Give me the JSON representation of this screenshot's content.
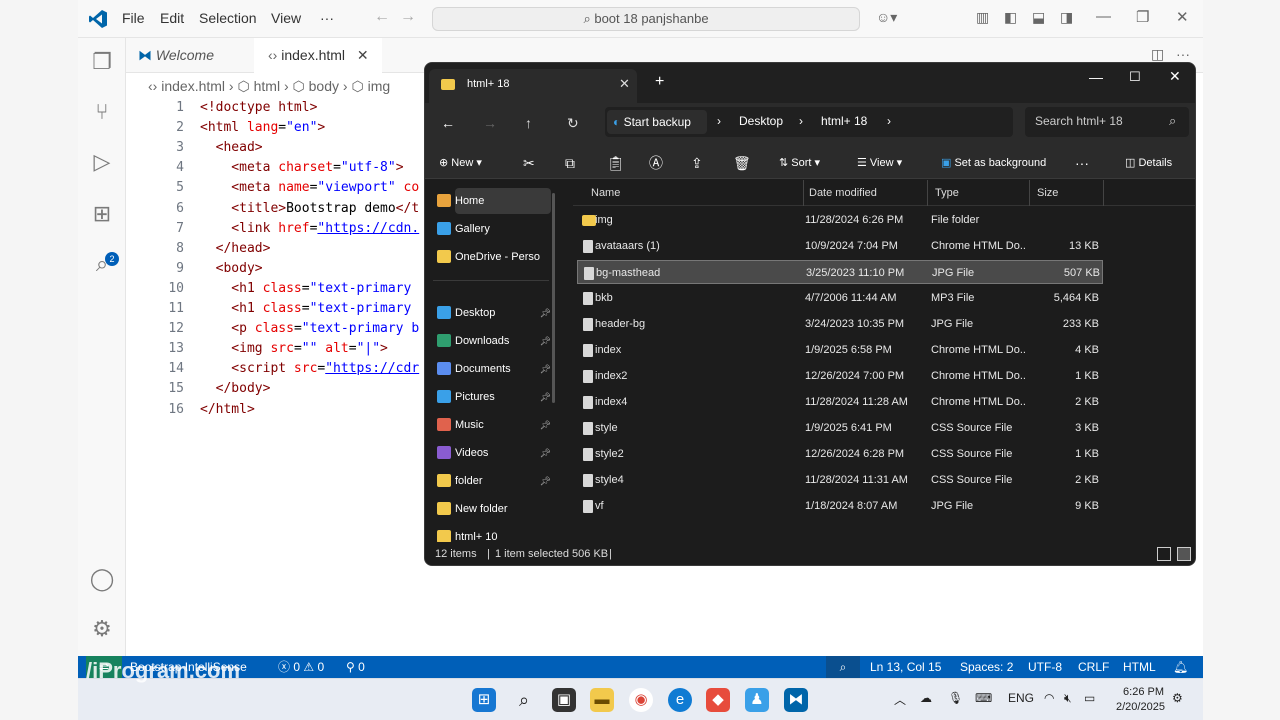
{
  "vscode": {
    "menu": [
      "File",
      "Edit",
      "Selection",
      "View",
      "···"
    ],
    "command_center": "boot 18 panjshanbe",
    "tabs": [
      {
        "label": "Welcome"
      },
      {
        "label": "index.html"
      }
    ],
    "breadcrumb": [
      "index.html",
      "html",
      "body",
      "img"
    ],
    "code_lines": [
      {
        "n": "1",
        "parts": [
          [
            "tag",
            "<!doctype html>"
          ]
        ]
      },
      {
        "n": "2",
        "parts": [
          [
            "tag",
            "<html "
          ],
          [
            "attr",
            "lang"
          ],
          [
            "pl",
            "="
          ],
          [
            "val",
            "\"en\""
          ],
          [
            "tag",
            ">"
          ]
        ]
      },
      {
        "n": "3",
        "parts": [
          [
            "tag",
            "  <head>"
          ]
        ]
      },
      {
        "n": "4",
        "parts": [
          [
            "tag",
            "    <meta "
          ],
          [
            "attr",
            "charset"
          ],
          [
            "pl",
            "="
          ],
          [
            "val",
            "\"utf-8\""
          ],
          [
            "tag",
            ">"
          ]
        ]
      },
      {
        "n": "5",
        "parts": [
          [
            "tag",
            "    <meta "
          ],
          [
            "attr",
            "name"
          ],
          [
            "pl",
            "="
          ],
          [
            "val",
            "\"viewport\""
          ],
          [
            "attr",
            " co"
          ]
        ]
      },
      {
        "n": "6",
        "parts": [
          [
            "tag",
            "    <title>"
          ],
          [
            "pl",
            "Bootstrap demo"
          ],
          [
            "tag",
            "</t"
          ]
        ]
      },
      {
        "n": "7",
        "parts": [
          [
            "tag",
            "    <link "
          ],
          [
            "attr",
            "href"
          ],
          [
            "pl",
            "="
          ],
          [
            "lnk",
            "\"https://cdn."
          ]
        ]
      },
      {
        "n": "8",
        "parts": [
          [
            "tag",
            "  </head>"
          ]
        ]
      },
      {
        "n": "9",
        "parts": [
          [
            "tag",
            "  <body>"
          ]
        ]
      },
      {
        "n": "10",
        "parts": [
          [
            "tag",
            "    <h1 "
          ],
          [
            "attr",
            "class"
          ],
          [
            "pl",
            "="
          ],
          [
            "val",
            "\"text-primary"
          ]
        ]
      },
      {
        "n": "11",
        "parts": [
          [
            "tag",
            "    <h1 "
          ],
          [
            "attr",
            "class"
          ],
          [
            "pl",
            "="
          ],
          [
            "val",
            "\"text-primary"
          ]
        ]
      },
      {
        "n": "12",
        "parts": [
          [
            "tag",
            "    <p "
          ],
          [
            "attr",
            "class"
          ],
          [
            "pl",
            "="
          ],
          [
            "val",
            "\"text-primary b"
          ]
        ]
      },
      {
        "n": "13",
        "parts": [
          [
            "tag",
            "    <img "
          ],
          [
            "attr",
            "src"
          ],
          [
            "pl",
            "="
          ],
          [
            "val",
            "\"\""
          ],
          [
            "attr",
            " alt"
          ],
          [
            "pl",
            "="
          ],
          [
            "val",
            "\"|\""
          ],
          [
            "tag",
            ">"
          ]
        ]
      },
      {
        "n": "14",
        "parts": [
          [
            "tag",
            "    <script "
          ],
          [
            "attr",
            "src"
          ],
          [
            "pl",
            "="
          ],
          [
            "lnk",
            "\"https://cdr"
          ]
        ]
      },
      {
        "n": "15",
        "parts": [
          [
            "tag",
            "  </body>"
          ]
        ]
      },
      {
        "n": "16",
        "parts": [
          [
            "tag",
            "</html>"
          ]
        ]
      }
    ],
    "status": {
      "remote": "Bootstrap IntelliSense",
      "errors": "0",
      "warnings": "0",
      "ports": "0",
      "position": "Ln 13, Col 15",
      "spaces": "Spaces: 2",
      "encoding": "UTF-8",
      "eol": "CRLF",
      "language": "HTML"
    },
    "watermark": "/iProgram.com",
    "taskbar": {
      "lang": "ENG",
      "time": "6:26 PM",
      "date": "2/20/2025"
    }
  },
  "explorer": {
    "tab_title": "html+ 18",
    "backup_label": "Start backup",
    "path": [
      "Desktop",
      "html+ 18"
    ],
    "search_placeholder": "Search html+ 18",
    "commands": {
      "new": "New",
      "sort": "Sort",
      "view": "View",
      "background": "Set as background",
      "details": "Details"
    },
    "sidebar": [
      {
        "label": "Home",
        "pinned": false,
        "color": "#e8a33d"
      },
      {
        "label": "Gallery",
        "pinned": false,
        "color": "#3aa0e8"
      },
      {
        "label": "OneDrive - Perso",
        "pinned": false,
        "color": "#f2c94c"
      },
      {
        "label": "Desktop",
        "pinned": true,
        "color": "#3aa0e8"
      },
      {
        "label": "Downloads",
        "pinned": true,
        "color": "#2f9e6f"
      },
      {
        "label": "Documents",
        "pinned": true,
        "color": "#5b8def"
      },
      {
        "label": "Pictures",
        "pinned": true,
        "color": "#3aa0e8"
      },
      {
        "label": "Music",
        "pinned": true,
        "color": "#e0624d"
      },
      {
        "label": "Videos",
        "pinned": true,
        "color": "#8a5cd1"
      },
      {
        "label": "folder",
        "pinned": true,
        "color": "#f2c94c"
      },
      {
        "label": "New folder",
        "pinned": false,
        "color": "#f2c94c"
      },
      {
        "label": "html+ 10",
        "pinned": false,
        "color": "#f2c94c"
      }
    ],
    "columns": [
      "Name",
      "Date modified",
      "Type",
      "Size"
    ],
    "files": [
      {
        "name": "img",
        "date": "11/28/2024 6:26 PM",
        "type": "File folder",
        "size": "",
        "folder": true,
        "selected": false
      },
      {
        "name": "avataaars (1)",
        "date": "10/9/2024 7:04 PM",
        "type": "Chrome HTML Do...",
        "size": "13 KB",
        "folder": false,
        "selected": false
      },
      {
        "name": "bg-masthead",
        "date": "3/25/2023 11:10 PM",
        "type": "JPG File",
        "size": "507 KB",
        "folder": false,
        "selected": true
      },
      {
        "name": "bkb",
        "date": "4/7/2006 11:44 AM",
        "type": "MP3 File",
        "size": "5,464 KB",
        "folder": false,
        "selected": false
      },
      {
        "name": "header-bg",
        "date": "3/24/2023 10:35 PM",
        "type": "JPG File",
        "size": "233 KB",
        "folder": false,
        "selected": false
      },
      {
        "name": "index",
        "date": "1/9/2025 6:58 PM",
        "type": "Chrome HTML Do...",
        "size": "4 KB",
        "folder": false,
        "selected": false
      },
      {
        "name": "index2",
        "date": "12/26/2024 7:00 PM",
        "type": "Chrome HTML Do...",
        "size": "1 KB",
        "folder": false,
        "selected": false
      },
      {
        "name": "index4",
        "date": "11/28/2024 11:28 AM",
        "type": "Chrome HTML Do...",
        "size": "2 KB",
        "folder": false,
        "selected": false
      },
      {
        "name": "style",
        "date": "1/9/2025 6:41 PM",
        "type": "CSS Source File",
        "size": "3 KB",
        "folder": false,
        "selected": false
      },
      {
        "name": "style2",
        "date": "12/26/2024 6:28 PM",
        "type": "CSS Source File",
        "size": "1 KB",
        "folder": false,
        "selected": false
      },
      {
        "name": "style4",
        "date": "11/28/2024 11:31 AM",
        "type": "CSS Source File",
        "size": "2 KB",
        "folder": false,
        "selected": false
      },
      {
        "name": "vf",
        "date": "1/18/2024 8:07 AM",
        "type": "JPG File",
        "size": "9 KB",
        "folder": false,
        "selected": false
      }
    ],
    "status_items": "12 items",
    "status_selected": "1 item selected  506 KB"
  }
}
